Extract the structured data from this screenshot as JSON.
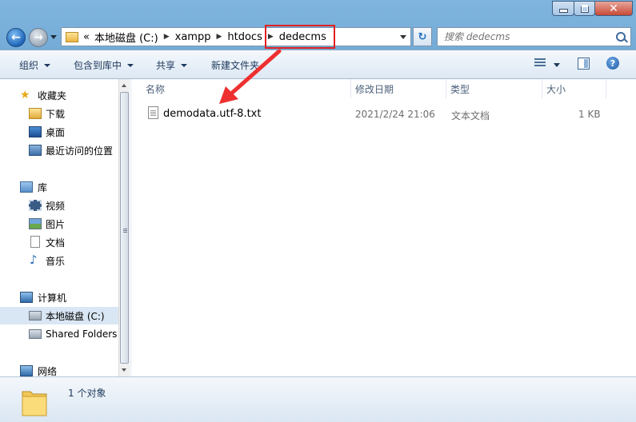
{
  "window": {
    "title": "",
    "controls": {
      "minimize": "minimize",
      "maximize": "maximize",
      "close": "close"
    }
  },
  "address": {
    "overflow": "«",
    "crumbs": [
      "本地磁盘 (C:)",
      "xampp",
      "htdocs",
      "dedecms"
    ],
    "highlight_color": "#e02020"
  },
  "search": {
    "placeholder": "搜索 dedecms"
  },
  "toolbar": {
    "organize": "组织",
    "include_library": "包含到库中",
    "share": "共享",
    "new_folder": "新建文件夹"
  },
  "sidebar": {
    "favorites": {
      "label": "收藏夹",
      "items": [
        "下载",
        "桌面",
        "最近访问的位置"
      ]
    },
    "libraries": {
      "label": "库",
      "items": [
        "视频",
        "图片",
        "文档",
        "音乐"
      ]
    },
    "computer": {
      "label": "计算机",
      "items": [
        "本地磁盘 (C:)",
        "Shared Folders"
      ]
    },
    "network": {
      "label": "网络"
    }
  },
  "columns": {
    "name": "名称",
    "modified": "修改日期",
    "type": "类型",
    "size": "大小"
  },
  "files": [
    {
      "name": "demodata.utf-8.txt",
      "modified": "2021/2/24 21:06",
      "type": "文本文档",
      "size": "1 KB",
      "icon": "text-file-icon"
    }
  ],
  "status": {
    "count_text": "1 个对象"
  },
  "annotation": {
    "arrow_color": "#ee3030"
  }
}
